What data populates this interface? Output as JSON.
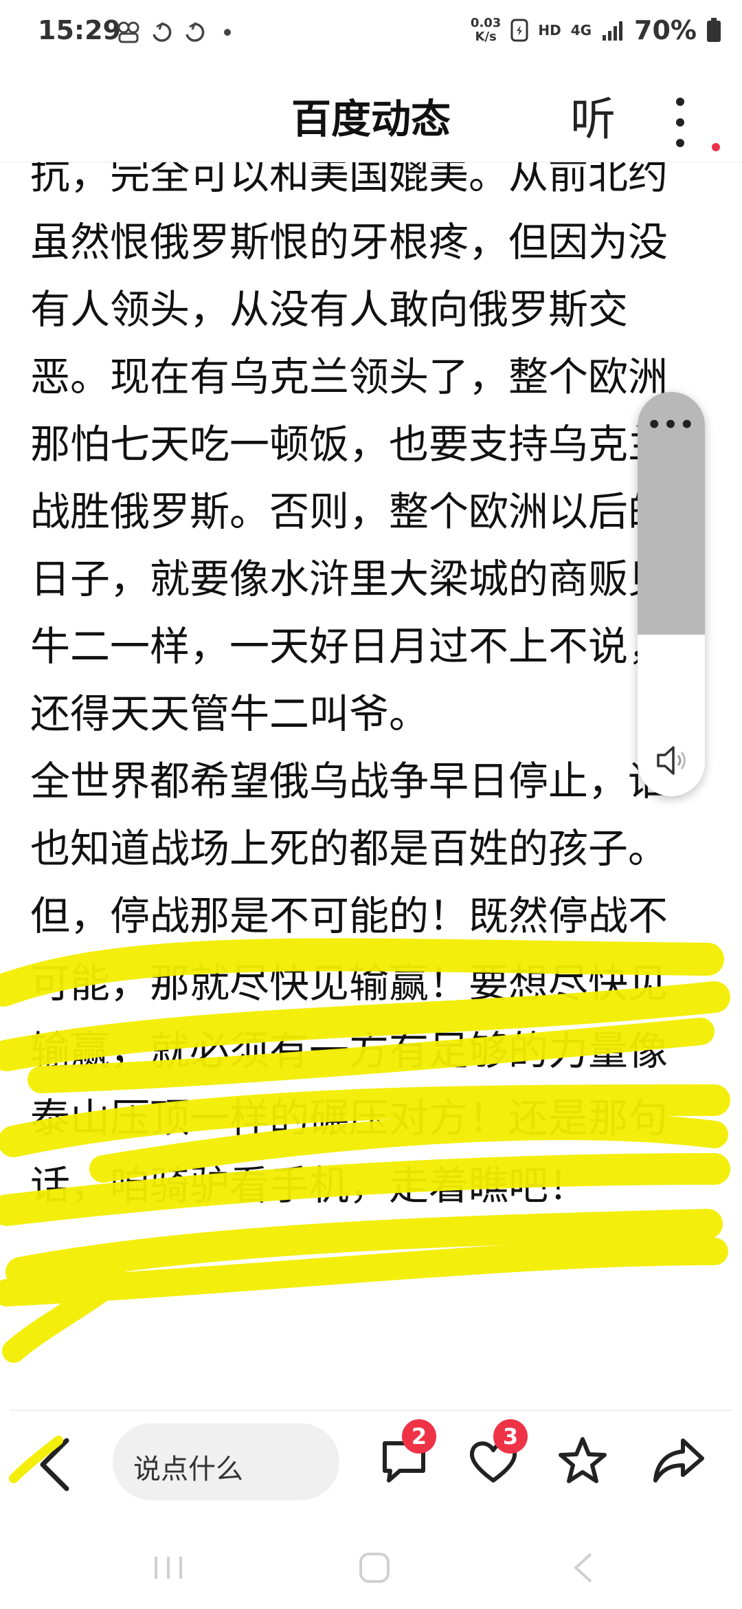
{
  "status_bar": {
    "time": "15:29",
    "net_speed_value": "0.03",
    "net_speed_unit": "K/s",
    "hd": "HD",
    "network": "4G",
    "battery": "70%"
  },
  "header": {
    "title": "百度动态",
    "listen_label": "听"
  },
  "article": {
    "paragraph1": "抗，完全可以和美国媲美。从前北约虽然恨俄罗斯恨的牙根疼，但因为没有人领头，从没有人敢向俄罗斯交恶。现在有乌克兰领头了，整个欧洲那怕七天吃一顿饭，也要支持乌克兰战胜俄罗斯。否则，整个欧洲以后的日子，就要像水浒里大梁城的商贩见牛二一样，一天好日月过不上不说，还得天天管牛二叫爷。",
    "paragraph2": "全世界都希望俄乌战争早日停止，谁也知道战场上死的都是百姓的孩子。但，停战那是不可能的！既然停战不可能，那就尽快见输赢！要想尽快见输赢，就必须有一方有足够的力量像泰山压顶一样的碾压对方！还是那句话，咱骑驴看手机，走着瞧吧！"
  },
  "audio_panel": {
    "more": "•••",
    "volume_level": 0.6
  },
  "bottom_bar": {
    "comment_placeholder": "说点什么",
    "comment_count": "2",
    "like_count": "3"
  },
  "colors": {
    "highlight": "#f4ee00",
    "badge": "#ef3347",
    "audio_fill": "#b8b8b8"
  },
  "icons": [
    "back-arrow-icon",
    "comment-icon",
    "heart-icon",
    "star-icon",
    "share-icon",
    "speaker-icon",
    "more-vertical-icon"
  ]
}
